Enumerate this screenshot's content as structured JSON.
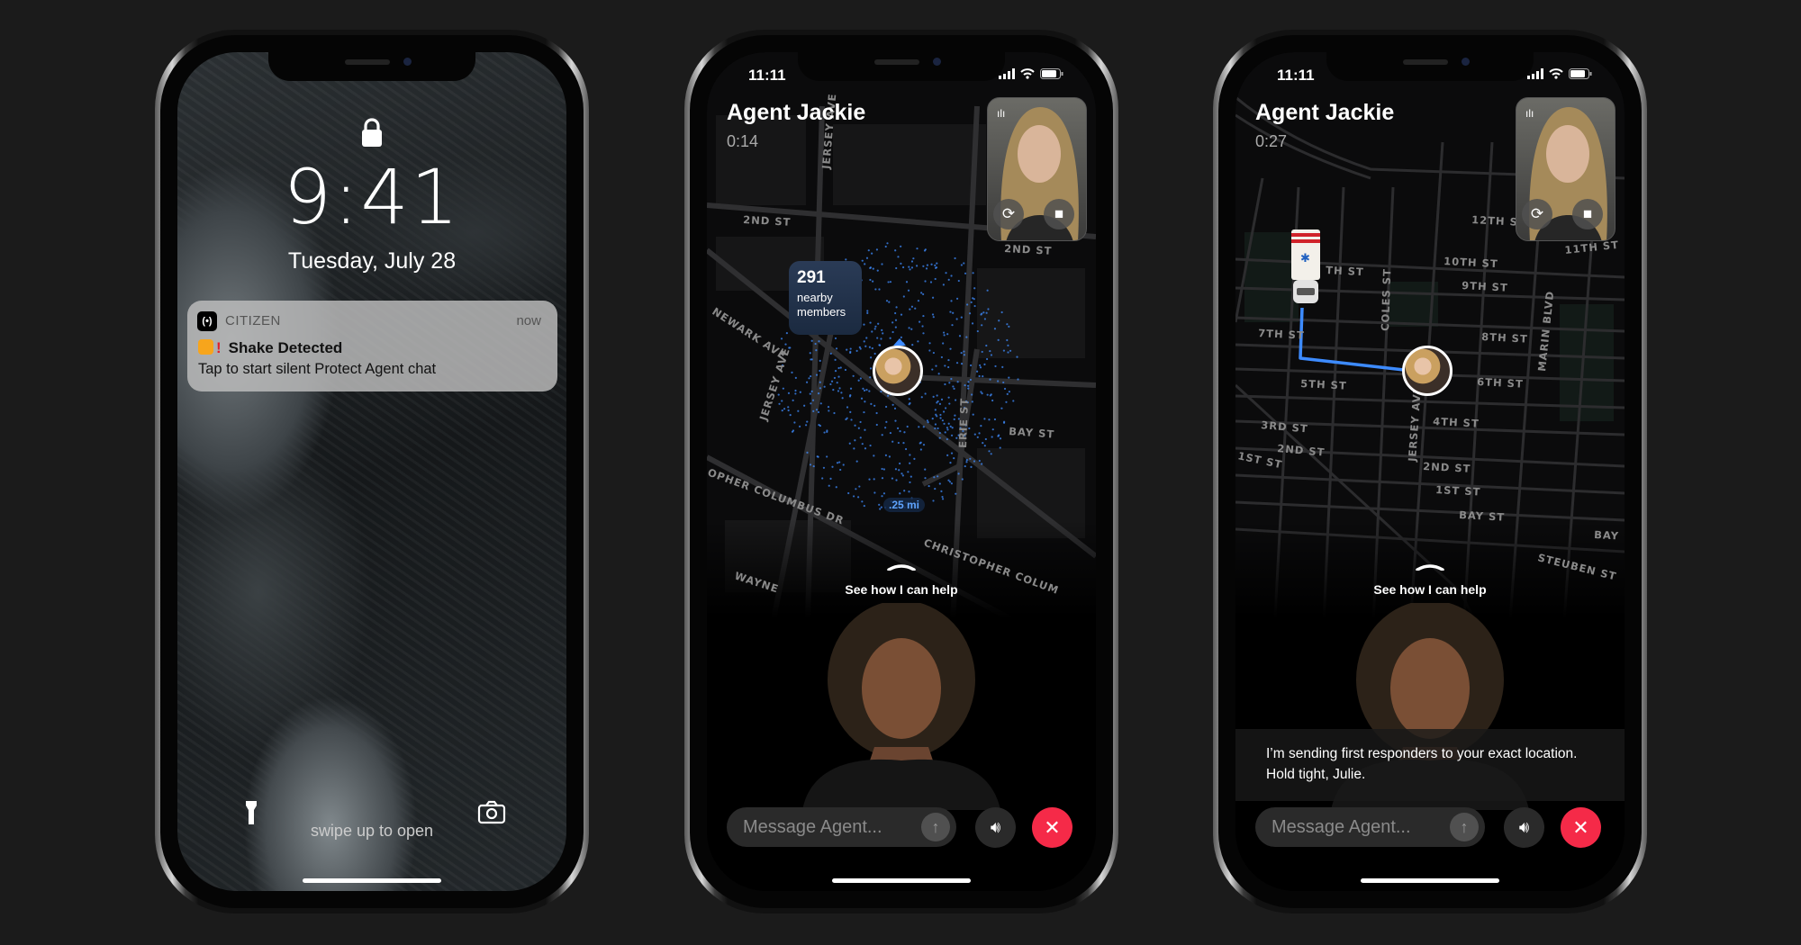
{
  "lock_screen": {
    "time": "9:41",
    "date": "Tuesday, July 28",
    "notification": {
      "app": "CITIZEN",
      "timestamp": "now",
      "title": "Shake Detected",
      "body": "Tap to start silent Protect Agent chat"
    },
    "swipe_hint": "swipe up to open",
    "icons": [
      "lock-icon",
      "flashlight-icon",
      "camera-icon"
    ]
  },
  "call_1": {
    "status_time": "11:11",
    "agent_name": "Agent Jackie",
    "duration": "0:14",
    "nearby_count": "291",
    "nearby_label": "nearby members",
    "distance": ".25 mi",
    "help_label": "See how I can help",
    "message_placeholder": "Message Agent...",
    "map_labels": [
      "2ND ST",
      "2ND ST",
      "JERSEY AVE",
      "NEWARK AVE",
      "JERSEY AVE",
      "ERIE ST",
      "BAY ST",
      "OPHER COLUMBUS DR",
      "CHRISTOPHER COLUM",
      "WAYNE"
    ]
  },
  "call_2": {
    "status_time": "11:11",
    "agent_name": "Agent Jackie",
    "duration": "0:27",
    "help_label": "See how I can help",
    "message_placeholder": "Message Agent...",
    "agent_message": "I’m sending first responders to your exact location. Hold tight, Julie.",
    "map_labels": [
      "12TH ST",
      "11TH ST",
      "10TH ST",
      "9TH ST",
      "TH ST",
      "8TH ST",
      "7TH ST",
      "6TH ST",
      "5TH ST",
      "4TH ST",
      "3RD ST",
      "2ND ST",
      "1ST ST",
      "2ND ST",
      "1ST ST",
      "BAY ST",
      "BAY",
      "COLES ST",
      "JERSEY AVE",
      "MARIN BLVD",
      "STEUBEN ST"
    ]
  },
  "colors": {
    "background": "#1b1b1b",
    "end_call": "#f52a48",
    "route": "#3d8bff",
    "member_dots": "#3f8cff"
  }
}
